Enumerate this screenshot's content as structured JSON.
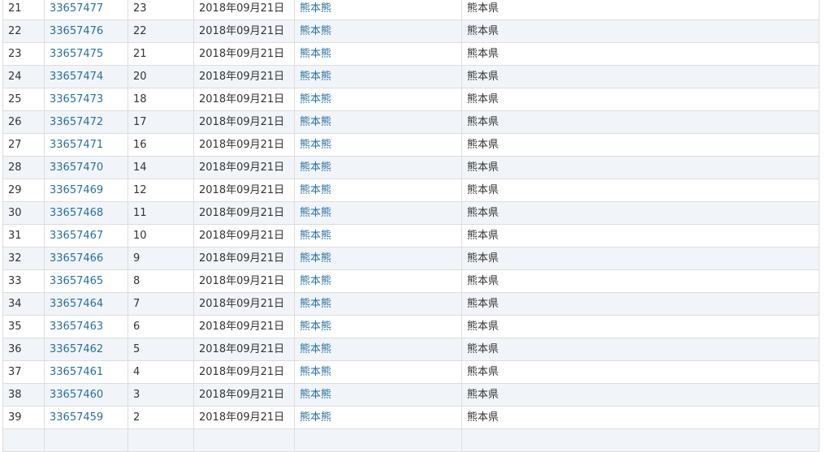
{
  "table": {
    "rows": [
      {
        "index": "21",
        "id": "33657477",
        "num": "23",
        "date": "2018年09月21日",
        "name": "熊本熊",
        "prefecture": "熊本県"
      },
      {
        "index": "22",
        "id": "33657476",
        "num": "22",
        "date": "2018年09月21日",
        "name": "熊本熊",
        "prefecture": "熊本県"
      },
      {
        "index": "23",
        "id": "33657475",
        "num": "21",
        "date": "2018年09月21日",
        "name": "熊本熊",
        "prefecture": "熊本県"
      },
      {
        "index": "24",
        "id": "33657474",
        "num": "20",
        "date": "2018年09月21日",
        "name": "熊本熊",
        "prefecture": "熊本県"
      },
      {
        "index": "25",
        "id": "33657473",
        "num": "18",
        "date": "2018年09月21日",
        "name": "熊本熊",
        "prefecture": "熊本県"
      },
      {
        "index": "26",
        "id": "33657472",
        "num": "17",
        "date": "2018年09月21日",
        "name": "熊本熊",
        "prefecture": "熊本県"
      },
      {
        "index": "27",
        "id": "33657471",
        "num": "16",
        "date": "2018年09月21日",
        "name": "熊本熊",
        "prefecture": "熊本県"
      },
      {
        "index": "28",
        "id": "33657470",
        "num": "14",
        "date": "2018年09月21日",
        "name": "熊本熊",
        "prefecture": "熊本県"
      },
      {
        "index": "29",
        "id": "33657469",
        "num": "12",
        "date": "2018年09月21日",
        "name": "熊本熊",
        "prefecture": "熊本県"
      },
      {
        "index": "30",
        "id": "33657468",
        "num": "11",
        "date": "2018年09月21日",
        "name": "熊本熊",
        "prefecture": "熊本県"
      },
      {
        "index": "31",
        "id": "33657467",
        "num": "10",
        "date": "2018年09月21日",
        "name": "熊本熊",
        "prefecture": "熊本県"
      },
      {
        "index": "32",
        "id": "33657466",
        "num": "9",
        "date": "2018年09月21日",
        "name": "熊本熊",
        "prefecture": "熊本県"
      },
      {
        "index": "33",
        "id": "33657465",
        "num": "8",
        "date": "2018年09月21日",
        "name": "熊本熊",
        "prefecture": "熊本県"
      },
      {
        "index": "34",
        "id": "33657464",
        "num": "7",
        "date": "2018年09月21日",
        "name": "熊本熊",
        "prefecture": "熊本県"
      },
      {
        "index": "35",
        "id": "33657463",
        "num": "6",
        "date": "2018年09月21日",
        "name": "熊本熊",
        "prefecture": "熊本県"
      },
      {
        "index": "36",
        "id": "33657462",
        "num": "5",
        "date": "2018年09月21日",
        "name": "熊本熊",
        "prefecture": "熊本県"
      },
      {
        "index": "37",
        "id": "33657461",
        "num": "4",
        "date": "2018年09月21日",
        "name": "熊本熊",
        "prefecture": "熊本県"
      },
      {
        "index": "38",
        "id": "33657460",
        "num": "3",
        "date": "2018年09月21日",
        "name": "熊本熊",
        "prefecture": "熊本県"
      },
      {
        "index": "39",
        "id": "33657459",
        "num": "2",
        "date": "2018年09月21日",
        "name": "熊本熊",
        "prefecture": "熊本県"
      }
    ]
  }
}
